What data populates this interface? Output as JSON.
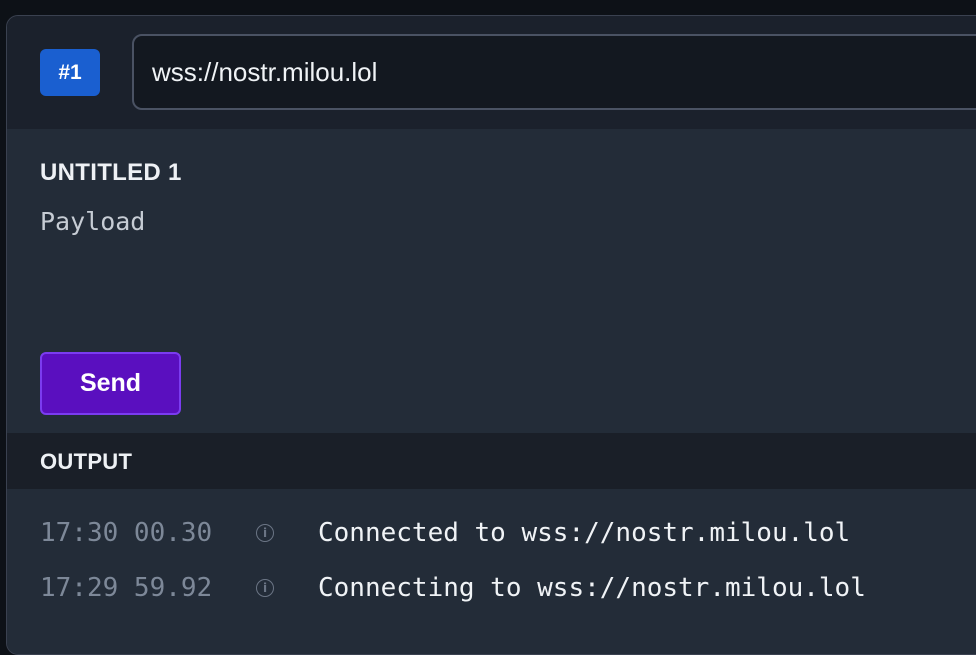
{
  "connection": {
    "badge": "#1",
    "url": "wss://nostr.milou.lol"
  },
  "editor": {
    "title": "UNTITLED 1",
    "payload_placeholder": "Payload",
    "send_label": "Send"
  },
  "output": {
    "title": "OUTPUT",
    "entries": [
      {
        "time": "17:30 00.30",
        "icon": "info-icon",
        "message": "Connected to wss://nostr.milou.lol"
      },
      {
        "time": "17:29 59.92",
        "icon": "info-icon",
        "message": "Connecting to wss://nostr.milou.lol"
      }
    ]
  },
  "colors": {
    "badge": "#1a5fd0",
    "send_button": "#5a0fbf",
    "send_border": "#7b3cf0"
  }
}
